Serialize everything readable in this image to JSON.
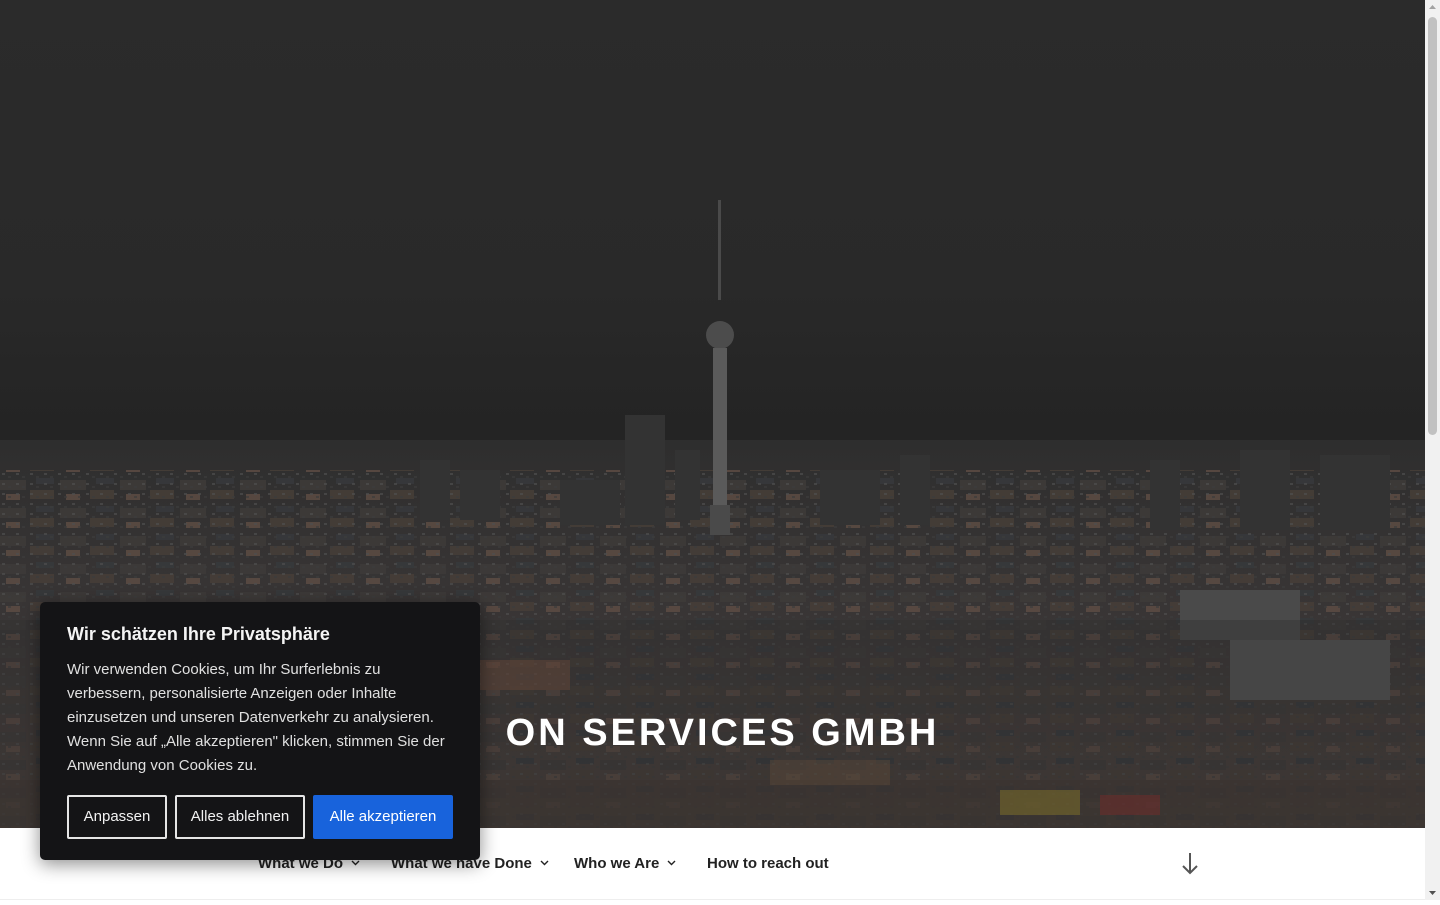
{
  "site": {
    "title_visible": "ON SERVICES GMBH"
  },
  "nav": {
    "items": [
      {
        "label": "What we Do",
        "has_dropdown": true
      },
      {
        "label": "What we have Done",
        "has_dropdown": true
      },
      {
        "label": "Who we Are",
        "has_dropdown": true
      },
      {
        "label": "How to reach out",
        "has_dropdown": false
      }
    ],
    "scroll_icon": "arrow-down-icon"
  },
  "cookie_banner": {
    "title": "Wir schätzen Ihre Privatsphäre",
    "text": "Wir verwenden Cookies, um Ihr Surferlebnis zu verbessern, personalisierte Anzeigen oder Inhalte einzusetzen und unseren Datenverkehr zu analysieren. Wenn Sie auf „Alle akzeptieren\" klicken, stimmen Sie der Anwendung von Cookies zu.",
    "buttons": {
      "customize": "Anpassen",
      "reject": "Alles ablehnen",
      "accept": "Alle akzeptieren"
    },
    "colors": {
      "background": "#141416",
      "accent": "#1863dc"
    }
  }
}
